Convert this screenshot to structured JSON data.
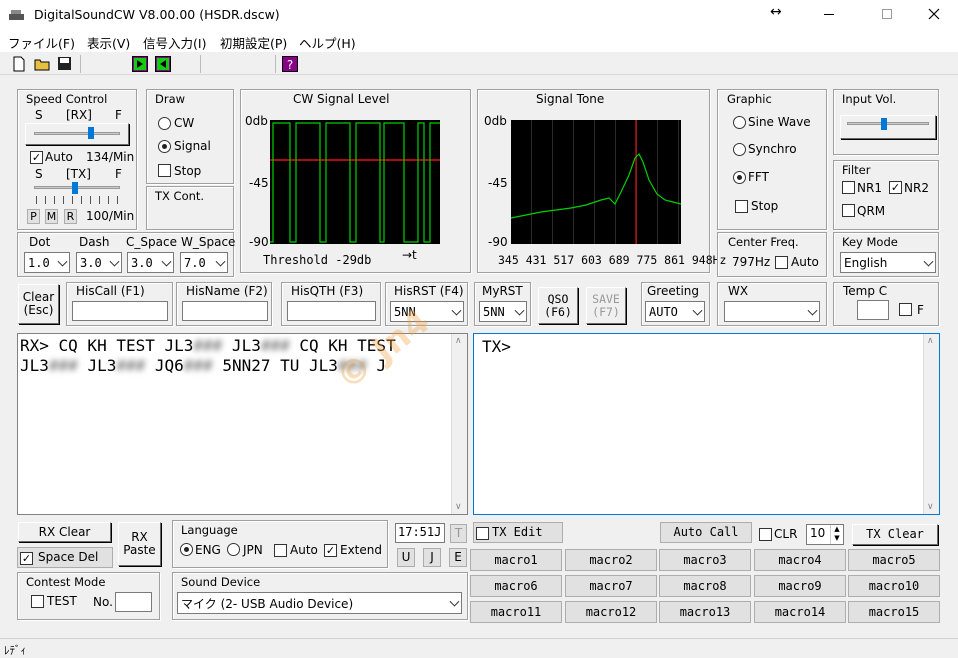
{
  "window": {
    "title": "DigitalSoundCW V8.00.00  (HSDR.dscw)",
    "status": "ﾚﾃﾞｨ",
    "resize_glyph": "↔"
  },
  "menu": [
    "ファイル(F)",
    "表示(V)",
    "信号入力(I)",
    "初期設定(P)",
    "ヘルプ(H)"
  ],
  "speed_control": {
    "title": "Speed Control",
    "s": "S",
    "f": "F",
    "rx_tag": "[RX]",
    "tx_tag": "[TX]",
    "auto_label": "Auto",
    "auto_checked": true,
    "rx_wpm": "134/Min",
    "tx_wpm": "100/Min",
    "p": "P",
    "m": "M",
    "r": "R"
  },
  "draw": {
    "title": "Draw",
    "options": [
      "CW",
      "Signal"
    ],
    "selected": "Signal",
    "stop": "Stop"
  },
  "tx_cont": "TX Cont.",
  "cw_level": {
    "title": "CW Signal Level",
    "y_top": "0db",
    "y_mid": "-45",
    "y_bot": "-90",
    "threshold": "Threshold -29db",
    "t_axis": "→t"
  },
  "tone": {
    "title": "Signal Tone",
    "y_top": "0db",
    "y_mid": "-45",
    "y_bot": "-90",
    "freq_axis": "345 431 517 603 689 775 861 948Hz"
  },
  "graphic": {
    "title": "Graphic",
    "options": [
      "Sine Wave",
      "Synchro",
      "FFT"
    ],
    "selected": "FFT",
    "stop": "Stop"
  },
  "input_vol": {
    "title": "Input Vol."
  },
  "filter": {
    "title": "Filter",
    "nr1": "NR1",
    "nr2": "NR2",
    "qrm": "QRM",
    "nr2_checked": true
  },
  "timing": {
    "dot": "Dot",
    "dash": "Dash",
    "c_space": "C_Space",
    "w_space": "W_Space",
    "dot_v": "1.0",
    "dash_v": "3.0",
    "c_space_v": "3.0",
    "w_space_v": "7.0"
  },
  "center_freq": {
    "title": "Center Freq.",
    "value": "797Hz",
    "auto": "Auto"
  },
  "key_mode": {
    "title": "Key Mode",
    "value": "English"
  },
  "log": {
    "clear": "Clear",
    "esc": "(Esc)",
    "hiscall": "HisCall  (F1)",
    "hisname": "HisName (F2)",
    "hisqth": "HisQTH (F3)",
    "hisrst": "HisRST (F4)",
    "hisrst_v": "5NN",
    "myrst": "MyRST",
    "myrst_v": "5NN",
    "qso": "QSO",
    "qso_k": "(F6)",
    "save": "SAVE",
    "save_k": "(F7)",
    "greeting": "Greeting",
    "greeting_v": "AUTO",
    "wx": "WX",
    "temp": "Temp C",
    "f": "F"
  },
  "rx": {
    "line1a": "RX> CQ KH TEST JL3",
    "b1": "###",
    "line1b": " JL3",
    "b2": "###",
    "line1c": " CQ KH TEST",
    "line2a": "JL3",
    "b3": "###",
    "line2b": " JL3",
    "b4": "###",
    "line2c": " JQ6",
    "b5": "###",
    "line2d": " 5NN27 TU JL3",
    "b6": "###",
    "line2e": " J"
  },
  "tx": {
    "text": "TX>",
    "edit": "TX Edit",
    "auto_call": "Auto Call",
    "clr": "CLR",
    "clr_n": "10",
    "clear": "TX Clear"
  },
  "watermark": "© Jn4",
  "bottom": {
    "rx_clear": "RX Clear",
    "rx_paste1": "RX",
    "rx_paste2": "Paste",
    "space_del": "Space Del",
    "language": "Language",
    "eng": "ENG",
    "jpn": "JPN",
    "lang_auto": "Auto",
    "extend": "Extend",
    "time": "17:51J",
    "t": "T",
    "u": "U",
    "j": "J",
    "e": "E",
    "contest": "Contest Mode",
    "test": "TEST",
    "no": "No.",
    "sound": "Sound Device",
    "sound_v": "マイク (2- USB Audio Device)"
  },
  "macros": [
    "macro1",
    "macro2",
    "macro3",
    "macro4",
    "macro5",
    "macro6",
    "macro7",
    "macro8",
    "macro9",
    "macro10",
    "macro11",
    "macro12",
    "macro13",
    "macro14",
    "macro15"
  ]
}
